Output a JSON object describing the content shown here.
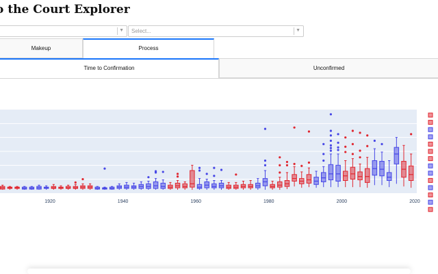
{
  "page": {
    "title": "o the Court Explorer"
  },
  "filters": {
    "left_dropdown": {
      "value": ""
    },
    "right_dropdown": {
      "placeholder": "Select..."
    }
  },
  "tabs_primary": [
    {
      "label": "Makeup",
      "selected": false
    },
    {
      "label": "Process",
      "selected": true
    }
  ],
  "tabs_secondary": [
    {
      "label": "Time to Confirmation",
      "selected": true
    },
    {
      "label": "Unconfirmed",
      "selected": false
    }
  ],
  "colors": {
    "red": "#e0262f",
    "blue": "#4646e6",
    "plot_bg": "#e5ecf6",
    "accent": "#1975fa"
  },
  "chart_data": {
    "type": "box",
    "x_tick_labels": [
      "1920",
      "1940",
      "1960",
      "1980",
      "2000",
      "2020"
    ],
    "xlim": [
      1901,
      2021
    ],
    "ylim": [
      0,
      120
    ],
    "grid": true,
    "legend_placement": "right (clipped)",
    "legend_entry_count": 14,
    "legend_colors": [
      "red",
      "red",
      "blue",
      "blue",
      "red",
      "red",
      "red",
      "blue",
      "blue",
      "red",
      "blue",
      "red",
      "blue",
      "red"
    ],
    "boxes": [
      {
        "x": 1901,
        "party": "R",
        "q1": 3,
        "med": 4,
        "q3": 6,
        "lo": 1,
        "hi": 8,
        "out": []
      },
      {
        "x": 1903,
        "party": "R",
        "q1": 3,
        "med": 4,
        "q3": 5,
        "lo": 1,
        "hi": 7,
        "out": [
          25
        ]
      },
      {
        "x": 1905,
        "party": "R",
        "q1": 3,
        "med": 4,
        "q3": 5,
        "lo": 1,
        "hi": 7,
        "out": []
      },
      {
        "x": 1907,
        "party": "R",
        "q1": 2,
        "med": 4,
        "q3": 6,
        "lo": 1,
        "hi": 8,
        "out": []
      },
      {
        "x": 1909,
        "party": "R",
        "q1": 3,
        "med": 4,
        "q3": 5,
        "lo": 1,
        "hi": 6,
        "out": []
      },
      {
        "x": 1911,
        "party": "R",
        "q1": 3,
        "med": 4,
        "q3": 5,
        "lo": 1,
        "hi": 6,
        "out": []
      },
      {
        "x": 1913,
        "party": "D",
        "q1": 2,
        "med": 3,
        "q3": 5,
        "lo": 1,
        "hi": 6,
        "out": []
      },
      {
        "x": 1915,
        "party": "D",
        "q1": 2,
        "med": 3,
        "q3": 5,
        "lo": 1,
        "hi": 6,
        "out": []
      },
      {
        "x": 1917,
        "party": "D",
        "q1": 2,
        "med": 4,
        "q3": 6,
        "lo": 1,
        "hi": 8,
        "out": []
      },
      {
        "x": 1919,
        "party": "D",
        "q1": 3,
        "med": 4,
        "q3": 5,
        "lo": 1,
        "hi": 7,
        "out": []
      },
      {
        "x": 1921,
        "party": "R",
        "q1": 3,
        "med": 4,
        "q3": 6,
        "lo": 1,
        "hi": 9,
        "out": []
      },
      {
        "x": 1923,
        "party": "R",
        "q1": 3,
        "med": 4,
        "q3": 5,
        "lo": 1,
        "hi": 7,
        "out": []
      },
      {
        "x": 1925,
        "party": "R",
        "q1": 3,
        "med": 4,
        "q3": 6,
        "lo": 1,
        "hi": 8,
        "out": []
      },
      {
        "x": 1927,
        "party": "R",
        "q1": 3,
        "med": 4,
        "q3": 6,
        "lo": 1,
        "hi": 9,
        "out": [
          12
        ]
      },
      {
        "x": 1929,
        "party": "R",
        "q1": 3,
        "med": 5,
        "q3": 7,
        "lo": 1,
        "hi": 10,
        "out": [
          17
        ]
      },
      {
        "x": 1931,
        "party": "R",
        "q1": 3,
        "med": 5,
        "q3": 7,
        "lo": 1,
        "hi": 10,
        "out": []
      },
      {
        "x": 1933,
        "party": "D",
        "q1": 2,
        "med": 3,
        "q3": 5,
        "lo": 1,
        "hi": 6,
        "out": []
      },
      {
        "x": 1935,
        "party": "D",
        "q1": 2,
        "med": 3,
        "q3": 4,
        "lo": 1,
        "hi": 5,
        "out": [
          33
        ]
      },
      {
        "x": 1937,
        "party": "D",
        "q1": 2,
        "med": 3,
        "q3": 5,
        "lo": 1,
        "hi": 6,
        "out": []
      },
      {
        "x": 1939,
        "party": "D",
        "q1": 3,
        "med": 5,
        "q3": 7,
        "lo": 1,
        "hi": 10,
        "out": []
      },
      {
        "x": 1941,
        "party": "D",
        "q1": 3,
        "med": 5,
        "q3": 8,
        "lo": 1,
        "hi": 12,
        "out": []
      },
      {
        "x": 1943,
        "party": "D",
        "q1": 3,
        "med": 5,
        "q3": 7,
        "lo": 1,
        "hi": 11,
        "out": []
      },
      {
        "x": 1945,
        "party": "D",
        "q1": 3,
        "med": 6,
        "q3": 9,
        "lo": 1,
        "hi": 13,
        "out": []
      },
      {
        "x": 1947,
        "party": "D",
        "q1": 3,
        "med": 6,
        "q3": 10,
        "lo": 1,
        "hi": 14,
        "out": [
          20
        ]
      },
      {
        "x": 1949,
        "party": "D",
        "q1": 3,
        "med": 7,
        "q3": 13,
        "lo": 1,
        "hi": 18,
        "out": [
          27,
          29
        ]
      },
      {
        "x": 1951,
        "party": "D",
        "q1": 3,
        "med": 6,
        "q3": 11,
        "lo": 1,
        "hi": 16,
        "out": [
          28
        ]
      },
      {
        "x": 1953,
        "party": "R",
        "q1": 3,
        "med": 5,
        "q3": 8,
        "lo": 1,
        "hi": 12,
        "out": []
      },
      {
        "x": 1955,
        "party": "R",
        "q1": 4,
        "med": 7,
        "q3": 11,
        "lo": 1,
        "hi": 15,
        "out": [
          21,
          25
        ]
      },
      {
        "x": 1957,
        "party": "R",
        "q1": 4,
        "med": 6,
        "q3": 10,
        "lo": 1,
        "hi": 13,
        "out": []
      },
      {
        "x": 1959,
        "party": "R",
        "q1": 5,
        "med": 10,
        "q3": 30,
        "lo": 1,
        "hi": 38,
        "out": []
      },
      {
        "x": 1961,
        "party": "D",
        "q1": 3,
        "med": 5,
        "q3": 9,
        "lo": 1,
        "hi": 18,
        "out": [
          30,
          34
        ]
      },
      {
        "x": 1963,
        "party": "D",
        "q1": 4,
        "med": 8,
        "q3": 13,
        "lo": 1,
        "hi": 17,
        "out": [
          25
        ]
      },
      {
        "x": 1965,
        "party": "D",
        "q1": 4,
        "med": 6,
        "q3": 10,
        "lo": 1,
        "hi": 15,
        "out": [
          22,
          34
        ]
      },
      {
        "x": 1967,
        "party": "D",
        "q1": 4,
        "med": 7,
        "q3": 11,
        "lo": 1,
        "hi": 15,
        "out": [
          31
        ]
      },
      {
        "x": 1969,
        "party": "R",
        "q1": 3,
        "med": 5,
        "q3": 8,
        "lo": 1,
        "hi": 12,
        "out": []
      },
      {
        "x": 1971,
        "party": "R",
        "q1": 3,
        "med": 5,
        "q3": 8,
        "lo": 1,
        "hi": 12,
        "out": [
          24
        ]
      },
      {
        "x": 1973,
        "party": "R",
        "q1": 4,
        "med": 6,
        "q3": 9,
        "lo": 1,
        "hi": 14,
        "out": []
      },
      {
        "x": 1975,
        "party": "R",
        "q1": 4,
        "med": 6,
        "q3": 9,
        "lo": 1,
        "hi": 15,
        "out": []
      },
      {
        "x": 1977,
        "party": "D",
        "q1": 4,
        "med": 7,
        "q3": 11,
        "lo": 1,
        "hi": 18,
        "out": []
      },
      {
        "x": 1979,
        "party": "D",
        "q1": 7,
        "med": 13,
        "q3": 18,
        "lo": 1,
        "hi": 30,
        "out": [
          38,
          45,
          93
        ]
      },
      {
        "x": 1981,
        "party": "R",
        "q1": 4,
        "med": 6,
        "q3": 9,
        "lo": 1,
        "hi": 14,
        "out": []
      },
      {
        "x": 1983,
        "party": "R",
        "q1": 5,
        "med": 8,
        "q3": 13,
        "lo": 1,
        "hi": 20,
        "out": [
          27,
          38,
          50
        ]
      },
      {
        "x": 1985,
        "party": "R",
        "q1": 6,
        "med": 10,
        "q3": 15,
        "lo": 2,
        "hi": 27,
        "out": [
          38,
          43
        ]
      },
      {
        "x": 1987,
        "party": "R",
        "q1": 14,
        "med": 18,
        "q3": 24,
        "lo": 6,
        "hi": 36,
        "out": [
          40,
          95
        ]
      },
      {
        "x": 1989,
        "party": "R",
        "q1": 10,
        "med": 14,
        "q3": 18,
        "lo": 4,
        "hi": 28,
        "out": [
          37
        ]
      },
      {
        "x": 1991,
        "party": "R",
        "q1": 11,
        "med": 16,
        "q3": 24,
        "lo": 5,
        "hi": 34,
        "out": [
          42,
          89
        ]
      },
      {
        "x": 1993,
        "party": "D",
        "q1": 9,
        "med": 14,
        "q3": 20,
        "lo": 4,
        "hi": 29,
        "out": []
      },
      {
        "x": 1995,
        "party": "D",
        "q1": 13,
        "med": 19,
        "q3": 27,
        "lo": 5,
        "hi": 36,
        "out": [
          45,
          55,
          70
        ]
      },
      {
        "x": 1997,
        "party": "D",
        "q1": 16,
        "med": 25,
        "q3": 39,
        "lo": 5,
        "hi": 55,
        "out": [
          60,
          64,
          68,
          75,
          83,
          90,
          115
        ]
      },
      {
        "x": 1999,
        "party": "D",
        "q1": 14,
        "med": 25,
        "q3": 38,
        "lo": 5,
        "hi": 55,
        "out": [
          61,
          65,
          72,
          85
        ]
      },
      {
        "x": 2001,
        "party": "R",
        "q1": 15,
        "med": 22,
        "q3": 29,
        "lo": 5,
        "hi": 45,
        "out": [
          58,
          66,
          80
        ]
      },
      {
        "x": 2003,
        "party": "R",
        "q1": 17,
        "med": 25,
        "q3": 35,
        "lo": 5,
        "hi": 48,
        "out": [
          55,
          70,
          90
        ]
      },
      {
        "x": 2005,
        "party": "R",
        "q1": 16,
        "med": 21,
        "q3": 28,
        "lo": 5,
        "hi": 40,
        "out": [
          50,
          60,
          87
        ]
      },
      {
        "x": 2007,
        "party": "R",
        "q1": 12,
        "med": 21,
        "q3": 33,
        "lo": 4,
        "hi": 50,
        "out": [
          67,
          83
        ]
      },
      {
        "x": 2009,
        "party": "D",
        "q1": 23,
        "med": 33,
        "q3": 45,
        "lo": 8,
        "hi": 63,
        "out": [
          75
        ]
      },
      {
        "x": 2011,
        "party": "D",
        "q1": 22,
        "med": 32,
        "q3": 44,
        "lo": 8,
        "hi": 58,
        "out": [
          70
        ]
      },
      {
        "x": 2013,
        "party": "D",
        "q1": 15,
        "med": 20,
        "q3": 27,
        "lo": 5,
        "hi": 45,
        "out": []
      },
      {
        "x": 2015,
        "party": "D",
        "q1": 40,
        "med": 55,
        "q3": 65,
        "lo": 10,
        "hi": 80,
        "out": []
      },
      {
        "x": 2017,
        "party": "R",
        "q1": 20,
        "med": 32,
        "q3": 44,
        "lo": 6,
        "hi": 68,
        "out": []
      },
      {
        "x": 2019,
        "party": "R",
        "q1": 15,
        "med": 24,
        "q3": 37,
        "lo": 4,
        "hi": 55,
        "out": [
          85
        ]
      }
    ]
  }
}
